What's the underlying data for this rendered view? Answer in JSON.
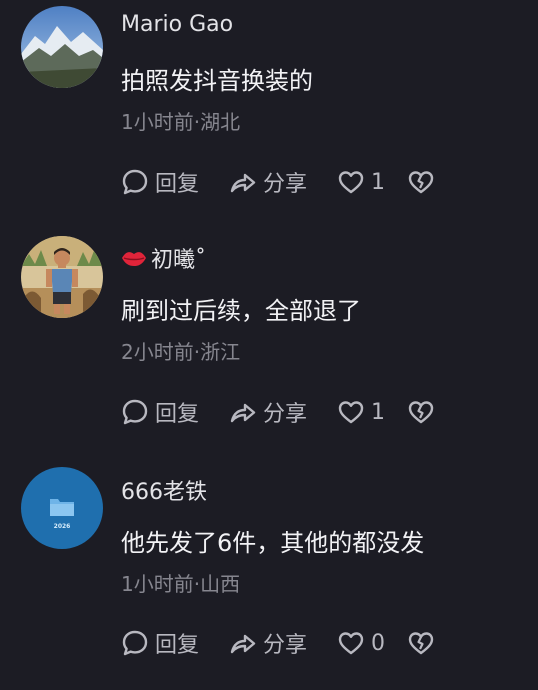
{
  "comments": [
    {
      "username": "Mario Gao",
      "text": "拍照发抖音换装的",
      "meta": "1小时前·湖北",
      "reply_label": "回复",
      "share_label": "分享",
      "likes": "1"
    },
    {
      "username": "初曦˚",
      "text": "刷到过后续，全部退了",
      "meta": "2小时前·浙江",
      "reply_label": "回复",
      "share_label": "分享",
      "likes": "1"
    },
    {
      "username": "666老铁",
      "text": "他先发了6件，其他的都没发",
      "meta": "1小时前·山西",
      "reply_label": "回复",
      "share_label": "分享",
      "likes": "0",
      "avatar_text": "2026"
    }
  ],
  "icons": {
    "reply": "speech-bubble-icon",
    "share": "share-arrow-icon",
    "like": "heart-icon",
    "dislike": "broken-heart-icon",
    "username_decor": "lips-icon"
  },
  "colors": {
    "background": "#1c1c24",
    "meta_text": "#86868f",
    "action_text": "#b8b8c0",
    "lips": "#e0243a"
  }
}
